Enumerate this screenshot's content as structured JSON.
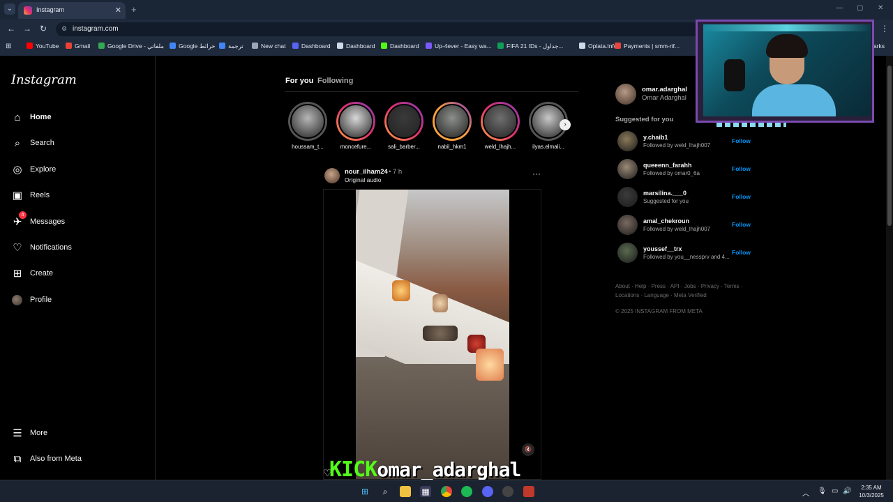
{
  "browser": {
    "tab_title": "Instagram",
    "tab_close": "✕",
    "new_tab": "+",
    "url": "instagram.com",
    "bookmarks": [
      {
        "label": "YouTube",
        "color": "#ff0000"
      },
      {
        "label": "Gmail",
        "color": "#ea4335"
      },
      {
        "label": "Google Drive - ملفاتي",
        "color": "#34a853"
      },
      {
        "label": "Google خرائط",
        "color": "#4285f4"
      },
      {
        "label": "ترجمة",
        "color": "#4285f4"
      },
      {
        "label": "New chat",
        "color": "#9aa6b8"
      },
      {
        "label": "Dashboard",
        "color": "#5865f2"
      },
      {
        "label": "Dashboard",
        "color": "#cfd8e6"
      },
      {
        "label": "Dashboard",
        "color": "#53fc18"
      },
      {
        "label": "Up-4ever - Easy wa...",
        "color": "#7a5af8"
      },
      {
        "label": "FIFA 21 IDs - جداول...",
        "color": "#0f9d58"
      },
      {
        "label": "Oplata.Info",
        "color": "#cfd8e6"
      },
      {
        "label": "Payments | smm-rif...",
        "color": "#e8453c"
      }
    ],
    "bookmarks_overflow": "arks"
  },
  "sidebar": {
    "logo": "Instagram",
    "items": [
      {
        "label": "Home",
        "icon": "home-icon",
        "glyph": "⌂"
      },
      {
        "label": "Search",
        "icon": "search-icon",
        "glyph": "⌕"
      },
      {
        "label": "Explore",
        "icon": "compass-icon",
        "glyph": "◎"
      },
      {
        "label": "Reels",
        "icon": "reels-icon",
        "glyph": "▣"
      },
      {
        "label": "Messages",
        "icon": "messenger-icon",
        "glyph": "✈",
        "badge": "4"
      },
      {
        "label": "Notifications",
        "icon": "heart-icon",
        "glyph": "♡"
      },
      {
        "label": "Create",
        "icon": "plus-square-icon",
        "glyph": "⊞"
      },
      {
        "label": "Profile",
        "icon": "profile-avatar",
        "glyph": ""
      }
    ],
    "bottom": [
      {
        "label": "More",
        "icon": "hamburger-icon",
        "glyph": "☰"
      },
      {
        "label": "Also from Meta",
        "icon": "meta-icon",
        "glyph": "⧉"
      }
    ]
  },
  "feed": {
    "tabs": [
      "For you",
      "Following"
    ],
    "stories": [
      {
        "name": "houssam_t...",
        "ring": "#555555",
        "img": "#b6b6b6"
      },
      {
        "name": "moncefure...",
        "ring": "#e1306c",
        "img": "#d8d8d8"
      },
      {
        "name": "sali_barber...",
        "ring": "#e1306c",
        "img": "#3a3a3a"
      },
      {
        "name": "nabil_hkm1",
        "ring": "#f9a03f",
        "img": "#8c8f8a"
      },
      {
        "name": "weld_lhajh...",
        "ring": "#e1306c",
        "img": "#6f6f6f"
      },
      {
        "name": "ilyas.elmali...",
        "ring": "#555555",
        "img": "#c8c8c8"
      }
    ],
    "post": {
      "user": "nour_ilham24",
      "time": "• 7 h",
      "audio": "Original audio",
      "more": "···"
    }
  },
  "right": {
    "me": {
      "user": "omar.adarghal",
      "name": "Omar Adarghal"
    },
    "suggested_title": "Suggested for you",
    "follow_label": "Follow",
    "suggestions": [
      {
        "user": "y.chaib1",
        "sub": "Followed by weld_lhajh007",
        "color": "#8a7a5a"
      },
      {
        "user": "queeenn_farahh",
        "sub": "Followed by omar0_6a",
        "color": "#9c8a76"
      },
      {
        "user": "marsilina.___0",
        "sub": "Suggested for you",
        "color": "#3b3b3b"
      },
      {
        "user": "amal_chekroun",
        "sub": "Followed by weld_lhajh007",
        "color": "#7a6a60"
      },
      {
        "user": "youssef__trx",
        "sub": "Followed by you__nessprv and 4...",
        "color": "#5a6a50"
      }
    ],
    "footer_line1": "About · Help · Press · API · Jobs · Privacy · Terms ·",
    "footer_line2": "Locations · Language · Meta Verified",
    "copyright": "© 2025 INSTAGRAM FROM META"
  },
  "overlay": {
    "kick_brand": "KICK",
    "kick_user": "omar_adarghal"
  },
  "taskbar": {
    "time": "2:35 AM",
    "date": "10/3/2025"
  }
}
